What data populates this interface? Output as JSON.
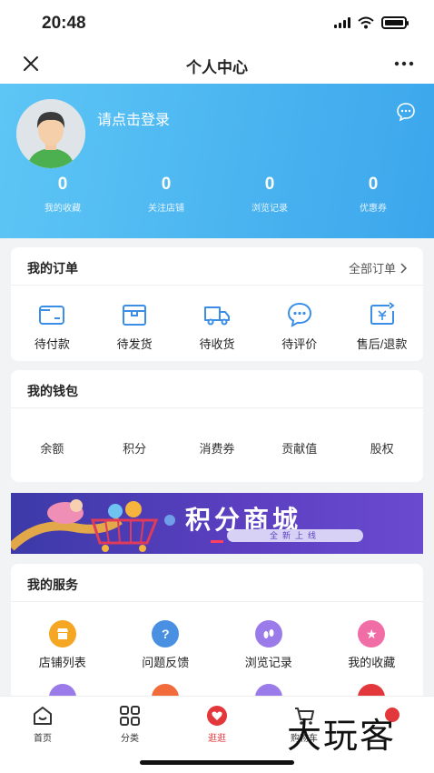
{
  "status_bar": {
    "time": "20:48"
  },
  "nav": {
    "title": "个人中心"
  },
  "profile": {
    "login_text": "请点击登录",
    "stats": [
      {
        "value": "0",
        "label": "我的收藏"
      },
      {
        "value": "0",
        "label": "关注店铺"
      },
      {
        "value": "0",
        "label": "浏览记录"
      },
      {
        "value": "0",
        "label": "优惠券"
      }
    ]
  },
  "orders": {
    "title": "我的订单",
    "all_link": "全部订单",
    "items": [
      {
        "label": "待付款",
        "icon": "wallet-icon"
      },
      {
        "label": "待发货",
        "icon": "box-icon"
      },
      {
        "label": "待收货",
        "icon": "truck-icon"
      },
      {
        "label": "待评价",
        "icon": "comment-icon"
      },
      {
        "label": "售后/退款",
        "icon": "refund-icon"
      }
    ]
  },
  "wallet": {
    "title": "我的钱包",
    "items": [
      "余额",
      "积分",
      "消费券",
      "贡献值",
      "股权"
    ]
  },
  "banner": {
    "title": "积分商城",
    "subtitle": "全新上线"
  },
  "services": {
    "title": "我的服务",
    "items": [
      {
        "label": "店铺列表",
        "icon": "store-icon",
        "color": "#f5a623"
      },
      {
        "label": "问题反馈",
        "icon": "question-icon",
        "color": "#4a90e2"
      },
      {
        "label": "浏览记录",
        "icon": "footprint-icon",
        "color": "#9b7bea"
      },
      {
        "label": "我的收藏",
        "icon": "star-icon",
        "color": "#f06da6"
      }
    ],
    "row2_icons": [
      {
        "icon": "footprint-icon",
        "color": "#9b7bea"
      },
      {
        "icon": "location-icon",
        "color": "#f26b3a"
      },
      {
        "icon": "heart-icon",
        "color": "#9b7bea"
      },
      {
        "icon": "service-icon",
        "color": "#e2383b"
      }
    ]
  },
  "tabbar": {
    "items": [
      {
        "label": "首页",
        "icon": "home-icon"
      },
      {
        "label": "分类",
        "icon": "grid-icon"
      },
      {
        "label": "逛逛",
        "icon": "browse-icon"
      },
      {
        "label": "购物车",
        "icon": "cart-icon"
      }
    ]
  },
  "watermark": "大玩客",
  "colors": {
    "accent": "#3ba6ec",
    "tab_active": "#e2383b",
    "order_icon": "#3a8ee6"
  }
}
